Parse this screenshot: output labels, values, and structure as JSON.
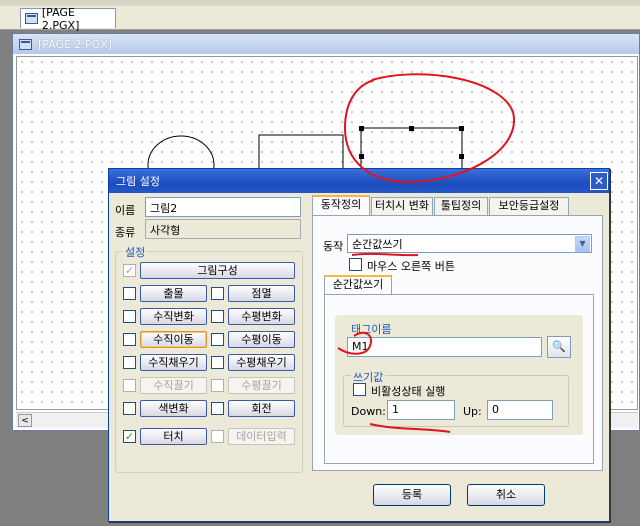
{
  "document_tab": {
    "label": "[PAGE 2.PGX]"
  },
  "mdi_window": {
    "title": "[PAGE 2.PGX]"
  },
  "dialog": {
    "title": "그림 설정",
    "name_label": "이름",
    "name_value": "그림2",
    "type_label": "종류",
    "type_value": "사각형",
    "settings_group_title": "설정",
    "settings": [
      {
        "label": "그림구성",
        "checked": true,
        "enabled": false
      },
      {
        "label": "출몰",
        "checked": false,
        "enabled": true
      },
      {
        "label": "점멸",
        "checked": false,
        "enabled": true
      },
      {
        "label": "수직변화",
        "checked": false,
        "enabled": true
      },
      {
        "label": "수평변화",
        "checked": false,
        "enabled": true
      },
      {
        "label": "수직이동",
        "checked": false,
        "enabled": true
      },
      {
        "label": "수평이동",
        "checked": false,
        "enabled": true
      },
      {
        "label": "수직채우기",
        "checked": false,
        "enabled": true
      },
      {
        "label": "수평채우기",
        "checked": false,
        "enabled": true
      },
      {
        "label": "수직끌기",
        "checked": false,
        "enabled": false
      },
      {
        "label": "수평끌기",
        "checked": false,
        "enabled": false
      },
      {
        "label": "색변화",
        "checked": false,
        "enabled": true
      },
      {
        "label": "회전",
        "checked": false,
        "enabled": true
      },
      {
        "label": "터치",
        "checked": true,
        "enabled": true
      },
      {
        "label": "데이터입력",
        "checked": false,
        "enabled": false
      }
    ],
    "tabs": [
      "동작정의",
      "터치시 변화",
      "툴팁정의",
      "보안등급설정"
    ],
    "action_label": "동작",
    "action_value": "순간값쓰기",
    "right_click_label": "마우스 오른쪽 버튼",
    "subtab_label": "순간값쓰기",
    "tag_name_label": "태그이름",
    "tag_name_value": "M1",
    "write_value_group_title": "쓰기값",
    "inactive_exec_label": "비활성상태 실행",
    "down_label": "Down:",
    "down_value": "1",
    "up_label": "Up:",
    "up_value": "0",
    "ok_label": "등록",
    "cancel_label": "취소"
  },
  "colors": {
    "dialog_title": "#1c4dbf",
    "annotation": "#e0141e",
    "check": "#21a121"
  }
}
